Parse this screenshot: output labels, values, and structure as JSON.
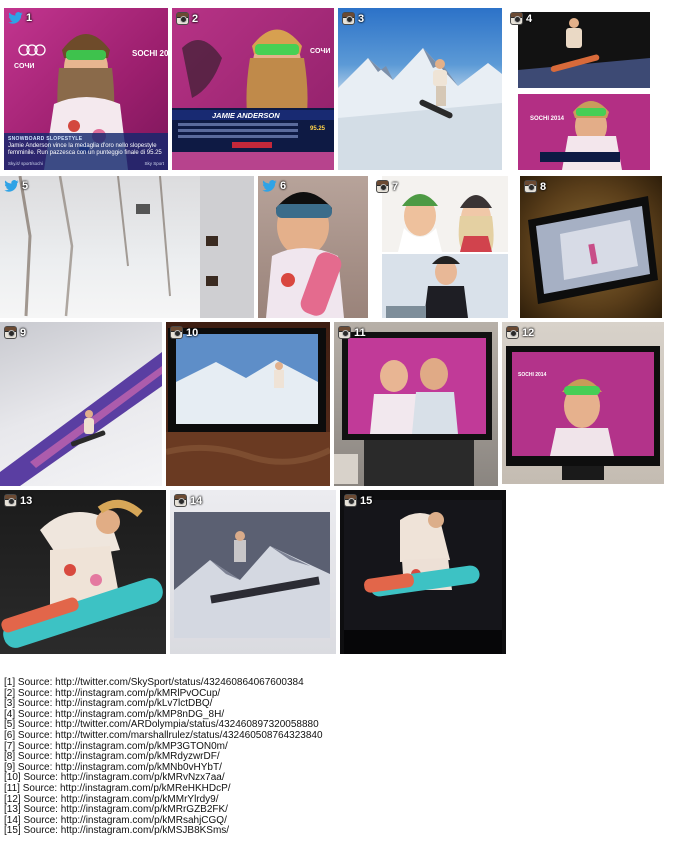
{
  "tiles": [
    {
      "num": "1",
      "icon": "twitter-icon"
    },
    {
      "num": "2",
      "icon": "instagram-icon"
    },
    {
      "num": "3",
      "icon": "instagram-icon"
    },
    {
      "num": "4",
      "icon": "instagram-icon"
    },
    {
      "num": "5",
      "icon": "twitter-icon"
    },
    {
      "num": "6",
      "icon": "twitter-icon"
    },
    {
      "num": "7",
      "icon": "instagram-icon"
    },
    {
      "num": "8",
      "icon": "instagram-icon"
    },
    {
      "num": "9",
      "icon": "instagram-icon"
    },
    {
      "num": "10",
      "icon": "instagram-icon"
    },
    {
      "num": "11",
      "icon": "instagram-icon"
    },
    {
      "num": "12",
      "icon": "instagram-icon"
    },
    {
      "num": "13",
      "icon": "instagram-icon"
    },
    {
      "num": "14",
      "icon": "instagram-icon"
    },
    {
      "num": "15",
      "icon": "instagram-icon"
    }
  ],
  "tile1_caption": {
    "kicker": "SNOWBOARD SLOPESTYLE",
    "text": "Jamie Anderson vince la medaglia d'oro nello slopestyle femminile. Run pazzesca con un punteggio finale di 95.25",
    "foot_left": "Sky.it/ sport/sochi",
    "foot_right": "Sky Sport"
  },
  "tile2_overlay": {
    "name": "JAMIE ANDERSON",
    "score": "95.25"
  },
  "sources": [
    "[1] Source: http://twitter.com/SkySport/status/432460864067600384",
    "[2] Source: http://instagram.com/p/kMRlPvOCup/",
    "[3] Source: http://instagram.com/p/kLv7lctDBQ/",
    "[4] Source: http://instagram.com/p/kMP8nDG_8H/",
    "[5] Source: http://twitter.com/ARDolympia/status/432460897320058880",
    "[6] Source: http://twitter.com/marshallrulez/status/432460508764323840",
    "[7] Source: http://instagram.com/p/kMP3GTON0m/",
    "[8] Source: http://instagram.com/p/kMRdyzwrDF/",
    "[9] Source: http://instagram.com/p/kMNb0vHYbT/",
    "[10] Source: http://instagram.com/p/kMRvNzx7aa/",
    "[11] Source: http://instagram.com/p/kMReHKHDcP/",
    "[12] Source: http://instagram.com/p/kMMrYlrdy9/",
    "[13] Source: http://instagram.com/p/kMRrGZB2FK/",
    "[14] Source: http://instagram.com/p/kMRsahjCGQ/",
    "[15] Source: http://instagram.com/p/kMSJB8KSms/"
  ],
  "colors": {
    "sochi_magenta": "#b0287e",
    "twitter_blue": "#2fa3e6",
    "snow_white": "#e9eef3",
    "tv_black": "#141414"
  }
}
